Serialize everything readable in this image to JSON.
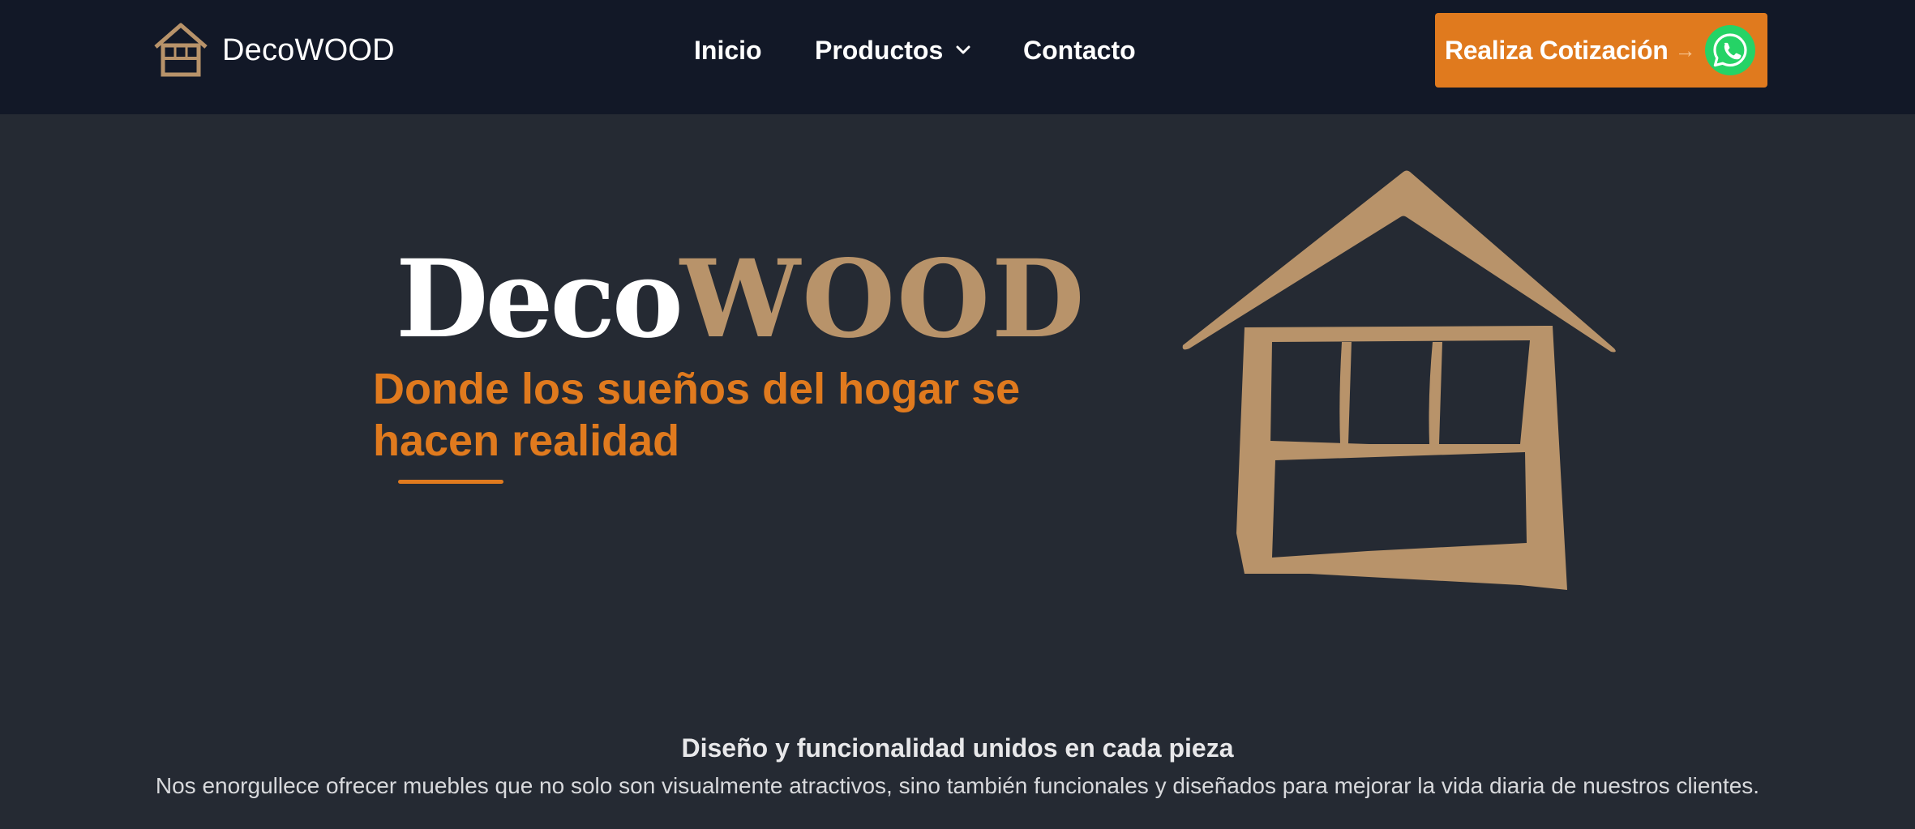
{
  "navbar": {
    "brand_name": "DecoWOOD",
    "links": [
      {
        "label": "Inicio"
      },
      {
        "label": "Productos",
        "icon": "chevron-down-icon"
      },
      {
        "label": "Contacto"
      }
    ],
    "cta": {
      "label": "Realiza Cotización",
      "arrow": "→",
      "icon": "whatsapp-icon"
    }
  },
  "hero": {
    "wordmark_part1": "Deco",
    "wordmark_part2": "WOOD",
    "tagline": "Donde los sueños del hogar se hacen realidad",
    "illustration_icon": "house-icon"
  },
  "feature": {
    "title": "Diseño y funcionalidad unidos en cada pieza",
    "text": "Nos enorgullece ofrecer muebles que no solo son visualmente atractivos, sino también funcionales y diseñados para mejorar la vida diaria de nuestros clientes."
  },
  "colors": {
    "navbar_bg": "#121827",
    "page_bg": "#252a33",
    "accent_orange": "#e07a1e",
    "wood_tan": "#b8936a",
    "whatsapp_green": "#25d366"
  }
}
